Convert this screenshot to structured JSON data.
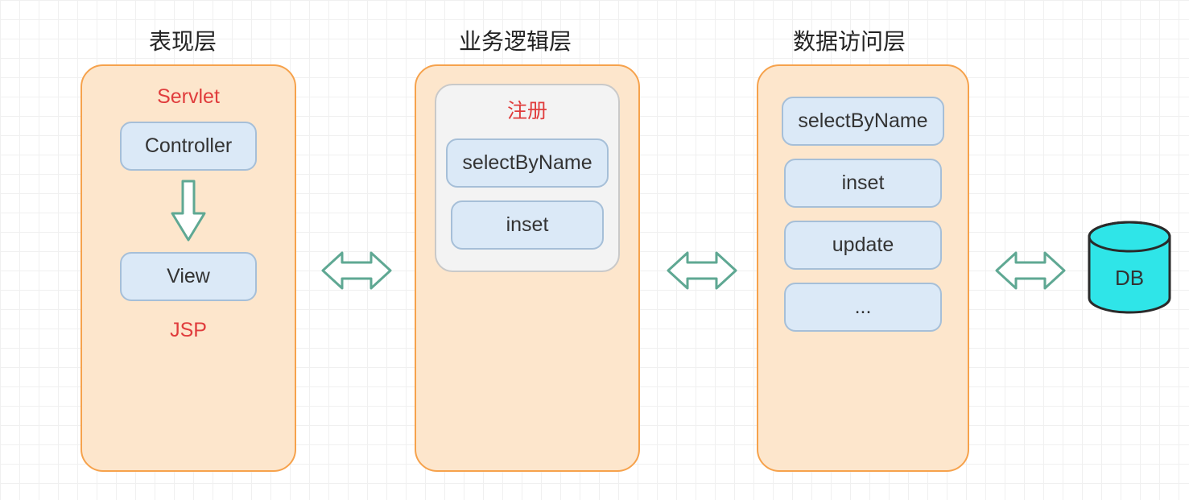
{
  "titles": {
    "presentation": "表现层",
    "business": "业务逻辑层",
    "dataaccess": "数据访问层"
  },
  "layer1": {
    "topLabel": "Servlet",
    "box1": "Controller",
    "box2": "View",
    "bottomLabel": "JSP"
  },
  "layer2": {
    "groupTitle": "注册",
    "box1": "selectByName",
    "box2": "inset"
  },
  "layer3": {
    "box1": "selectByName",
    "box2": "inset",
    "box3": "update",
    "box4": "..."
  },
  "db": {
    "label": "DB"
  },
  "colors": {
    "panelFill": "#fde6cc",
    "panelStroke": "#f6a24c",
    "boxFill": "#dbe9f7",
    "boxStroke": "#a6bfd8",
    "arrow": "#5fa893",
    "dbFill": "#2fe5e8",
    "red": "#e03c3c"
  }
}
